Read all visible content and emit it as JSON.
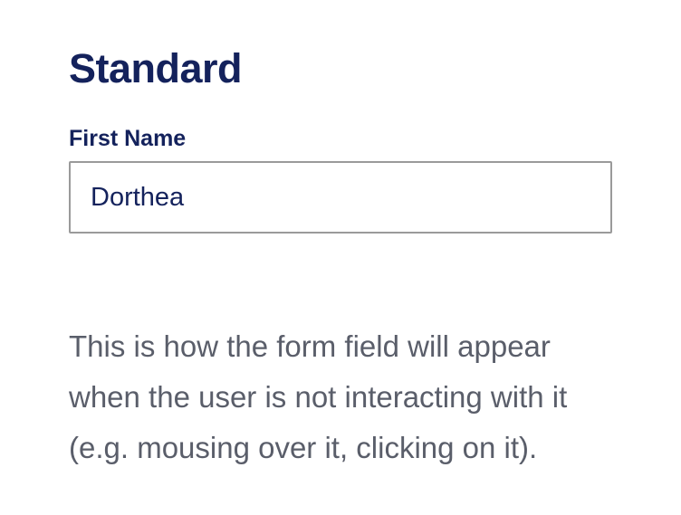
{
  "section": {
    "title": "Standard",
    "field": {
      "label": "First Name",
      "value": "Dorthea"
    }
  },
  "description": "This is how the form field will appear when the user is not interacting with it (e.g. mousing over it, clicking on it).",
  "colors": {
    "heading": "#14225c",
    "label": "#14225c",
    "input_text": "#14225c",
    "input_border": "#9a9a9a",
    "description_text": "#5a5e6a",
    "background": "#ffffff"
  }
}
